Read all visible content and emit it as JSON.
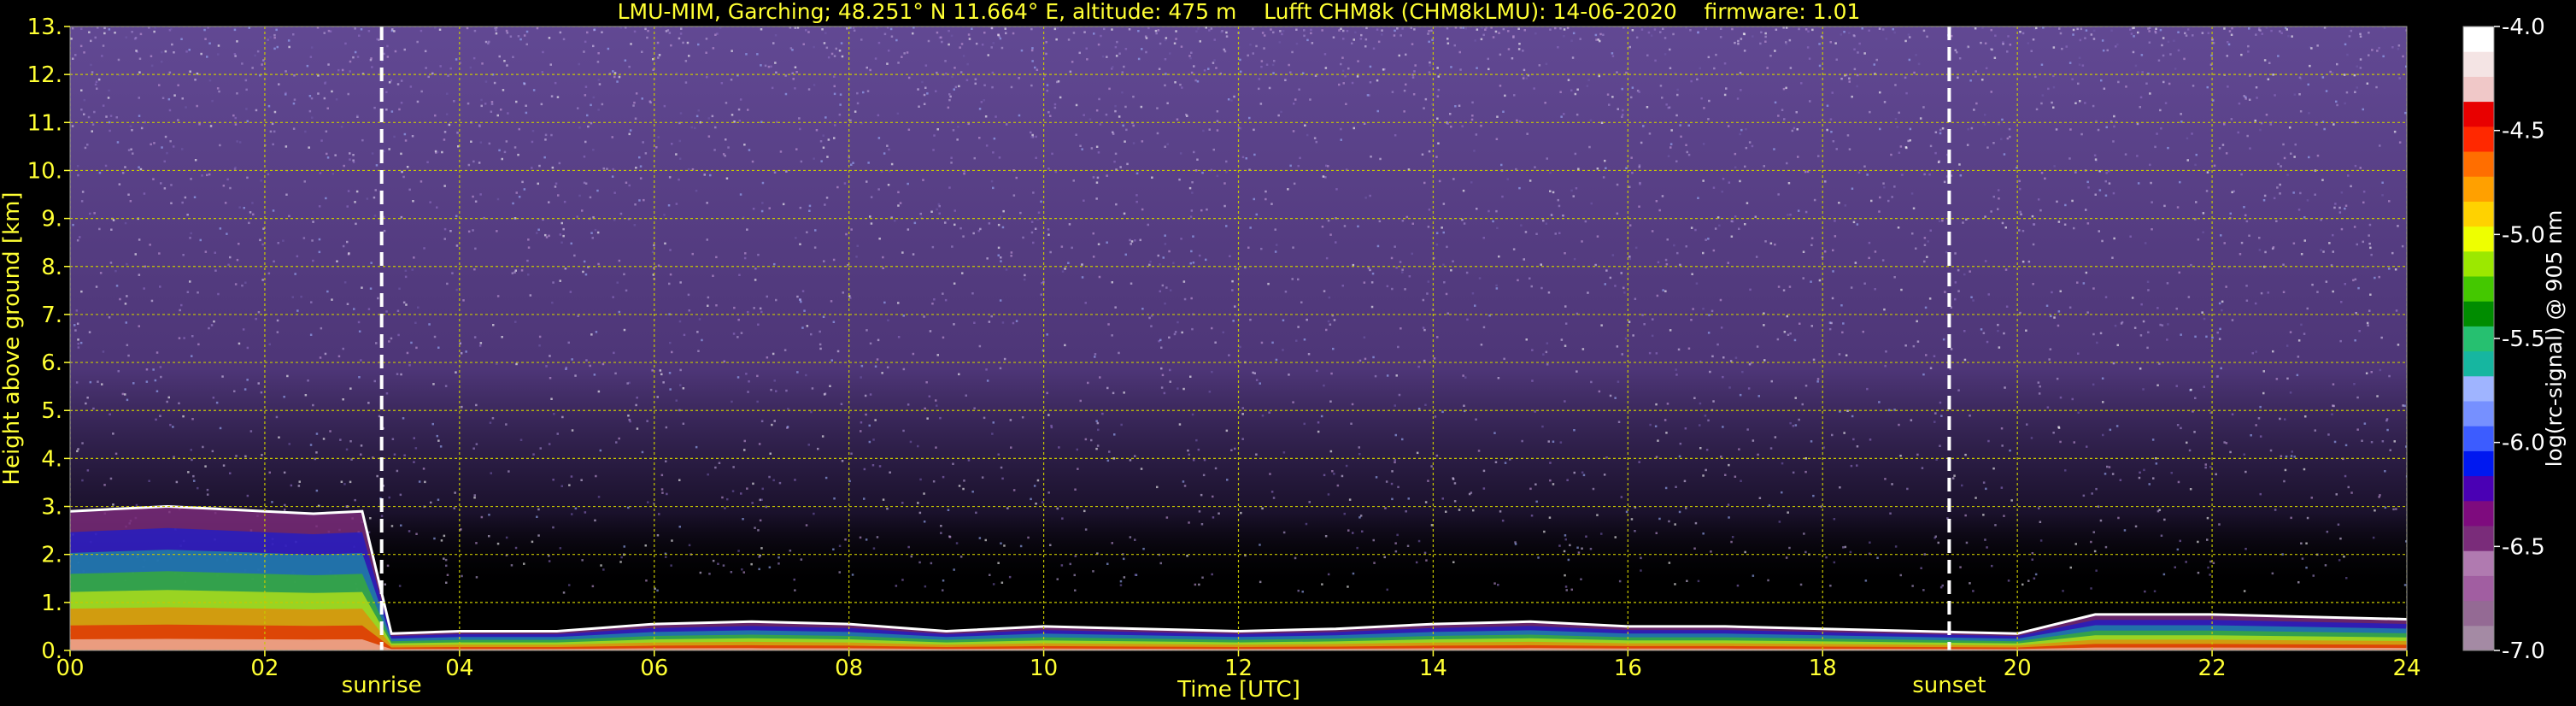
{
  "chart_data": {
    "type": "heatmap",
    "title": "LMU-MIM, Garching; 48.251° N 11.664° E, altitude: 475 m    Lufft CHM8k (CHM8kLMU): 14-06-2020    firmware: 1.01",
    "xlabel": "Time [UTC]",
    "ylabel": "Height above ground [km]",
    "xlim": [
      0,
      24
    ],
    "ylim": [
      0,
      13
    ],
    "x_ticks": [
      "00",
      "02",
      "04",
      "06",
      "08",
      "10",
      "12",
      "14",
      "16",
      "18",
      "20",
      "22",
      "24"
    ],
    "y_ticks": [
      "0.",
      "1.",
      "2.",
      "3.",
      "4.",
      "5.",
      "6.",
      "7.",
      "8.",
      "9.",
      "10.",
      "11.",
      "12.",
      "13."
    ],
    "grid": true,
    "colorbar": {
      "label": "log(rc-signal) @ 905 nm",
      "range": [
        -7.0,
        -4.0
      ],
      "ticks": [
        "-4.0",
        "-4.5",
        "-5.0",
        "-5.5",
        "-6.0",
        "-6.5",
        "-7.0"
      ],
      "colors": [
        "#a48aa4",
        "#946a94",
        "#a15ea1",
        "#b07ab0",
        "#7a2c7a",
        "#7e0b7e",
        "#4a00b4",
        "#0018f0",
        "#3c5cff",
        "#7690ff",
        "#9fb4ff",
        "#16b6a0",
        "#26c070",
        "#008c00",
        "#44c800",
        "#9ce800",
        "#eeff00",
        "#ffd200",
        "#ffa000",
        "#ff6e00",
        "#ff2800",
        "#e80000",
        "#f0c8c8",
        "#f4e4e4",
        "#ffffff"
      ]
    },
    "annotations": [
      {
        "text": "sunrise",
        "x": 3.2
      },
      {
        "text": "sunset",
        "x": 19.3
      }
    ],
    "boundary_layer_top_km": [
      [
        0.0,
        2.9
      ],
      [
        0.5,
        2.95
      ],
      [
        1.0,
        3.0
      ],
      [
        1.5,
        2.95
      ],
      [
        2.0,
        2.9
      ],
      [
        2.5,
        2.85
      ],
      [
        3.0,
        2.9
      ],
      [
        3.3,
        0.35
      ],
      [
        4.0,
        0.4
      ],
      [
        5.0,
        0.4
      ],
      [
        6.0,
        0.55
      ],
      [
        7.0,
        0.6
      ],
      [
        8.0,
        0.55
      ],
      [
        9.0,
        0.4
      ],
      [
        10.0,
        0.5
      ],
      [
        11.0,
        0.45
      ],
      [
        12.0,
        0.4
      ],
      [
        13.0,
        0.45
      ],
      [
        14.0,
        0.55
      ],
      [
        15.0,
        0.6
      ],
      [
        16.0,
        0.5
      ],
      [
        17.0,
        0.5
      ],
      [
        18.0,
        0.45
      ],
      [
        19.0,
        0.4
      ],
      [
        20.0,
        0.35
      ],
      [
        20.8,
        0.75
      ],
      [
        22.0,
        0.75
      ],
      [
        23.0,
        0.7
      ],
      [
        24.0,
        0.65
      ]
    ]
  }
}
